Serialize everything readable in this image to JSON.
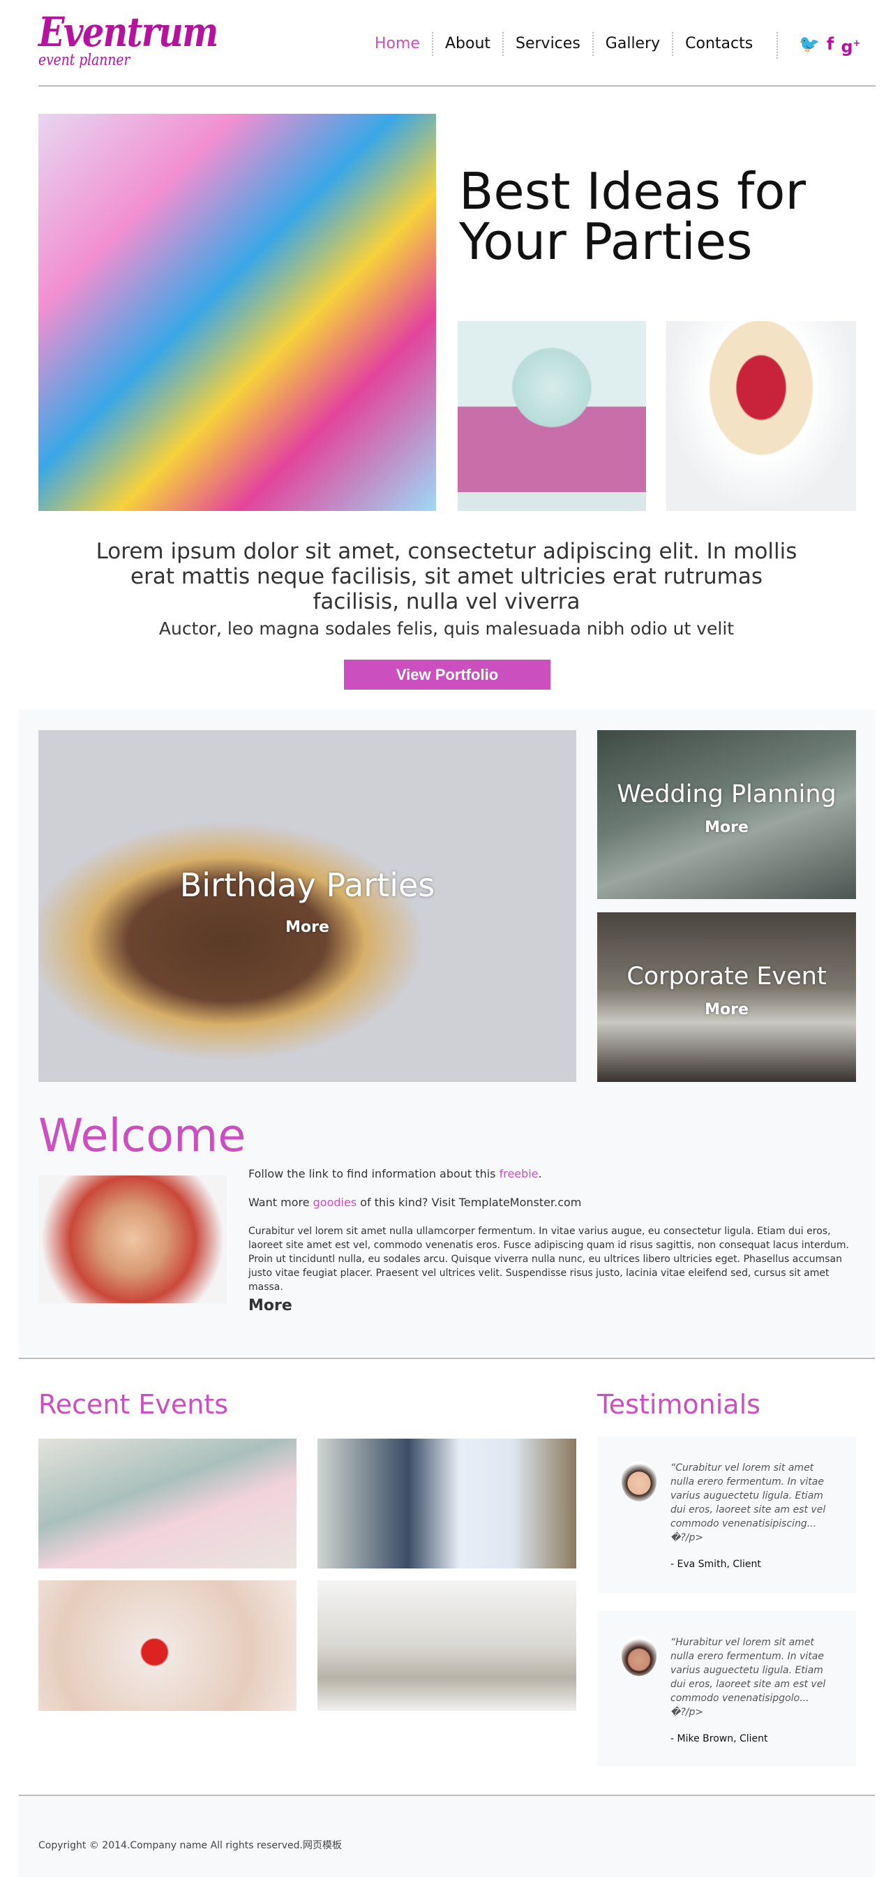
{
  "header": {
    "logo_title": "Eventrum",
    "logo_subtitle": "event planner",
    "nav": [
      {
        "label": "Home",
        "active": true
      },
      {
        "label": "About"
      },
      {
        "label": "Services"
      },
      {
        "label": "Gallery"
      },
      {
        "label": "Contacts"
      }
    ],
    "social": [
      {
        "icon": "twitter-icon",
        "glyph": "🐦"
      },
      {
        "icon": "facebook-icon",
        "glyph": "f"
      },
      {
        "icon": "google-plus-icon",
        "glyph": "g+"
      }
    ]
  },
  "hero": {
    "title_line1": "Best Ideas for",
    "title_line2": "Your Parties",
    "lead": "Lorem ipsum dolor sit amet, consectetur adipiscing elit. In mollis erat mattis neque facilisis, sit amet ultricies erat rutrumas facilisis, nulla vel viverra",
    "sub": "Auctor, leo magna sodales felis, quis malesuada nibh odio ut velit",
    "button": "View Portfolio"
  },
  "tiles": [
    {
      "title": "Birthday Parties",
      "more": "More"
    },
    {
      "title": "Wedding Planning",
      "more": "More"
    },
    {
      "title": "Corporate Event",
      "more": "More"
    }
  ],
  "welcome": {
    "title": "Welcome",
    "line1_pre": "Follow the link to find information about this ",
    "line1_link": "freebie",
    "line1_post": ".",
    "line2_pre": "Want more ",
    "line2_link": "goodies",
    "line2_post": " of this kind? Visit TemplateMonster.com",
    "body": "Curabitur vel lorem sit amet nulla ullamcorper fermentum. In vitae varius augue, eu consectetur ligula. Etiam dui eros, laoreet site amet est vel, commodo venenatis eros. Fusce adipiscing quam id risus sagittis, non consequat lacus interdum. Proin ut tinciduntl nulla, eu sodales arcu. Quisque viverra nulla nunc, eu ultrices libero ultricies eget. Phasellus accumsan justo vitae feugiat placer. Praesent vel ultrices velit. Suspendisse risus justo, lacinia vitae eleifend sed, cursus sit amet massa.",
    "more": "More"
  },
  "recent": {
    "title": "Recent Events"
  },
  "testimonials": {
    "title": "Testimonials",
    "items": [
      {
        "quote": "“Curabitur vel lorem sit amet nulla erero fermentum. In vitae varius auguectetu ligula. Etiam dui eros, laoreet site am est vel commodo venenatisipiscing... �?/p>",
        "author": "- Eva Smith, Client"
      },
      {
        "quote": "“Hurabitur vel lorem sit amet nulla erero fermentum. In vitae varius auguectetu ligula. Etiam dui eros, laoreet site am est vel commodo venenatisipgolo... �?/p>",
        "author": "- Mike Brown, Client"
      }
    ]
  },
  "footer": {
    "copyright": "Copyright © 2014.Company name All rights reserved.网页模板"
  },
  "colors": {
    "accent": "#cc4fc0",
    "logo": "#b5139e"
  }
}
